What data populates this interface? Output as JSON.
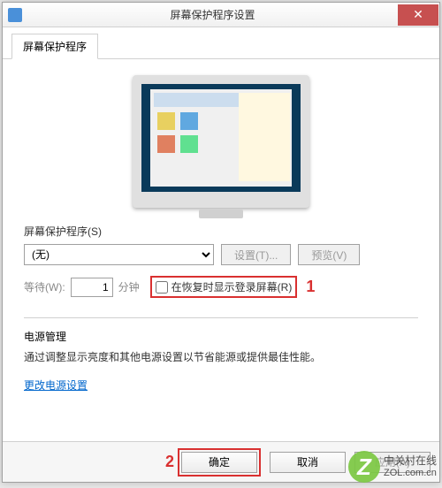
{
  "window": {
    "title": "屏幕保护程序设置",
    "close": "✕"
  },
  "tab": {
    "label": "屏幕保护程序"
  },
  "saver": {
    "group_label": "屏幕保护程序(S)",
    "selected": "(无)",
    "settings_btn": "设置(T)...",
    "preview_btn": "预览(V)"
  },
  "wait": {
    "label": "等待(W):",
    "value": "1",
    "unit": "分钟",
    "resume_checkbox": "在恢复时显示登录屏幕(R)"
  },
  "power": {
    "heading": "电源管理",
    "desc": "通过调整显示亮度和其他电源设置以节省能源或提供最佳性能。",
    "link": "更改电源设置"
  },
  "footer": {
    "ok": "确定",
    "cancel": "取消",
    "apply": "应用(A)"
  },
  "annotations": {
    "one": "1",
    "two": "2"
  },
  "watermark": {
    "z": "Z",
    "cn": "中关村在线",
    "url": "ZOL.com.cn"
  }
}
